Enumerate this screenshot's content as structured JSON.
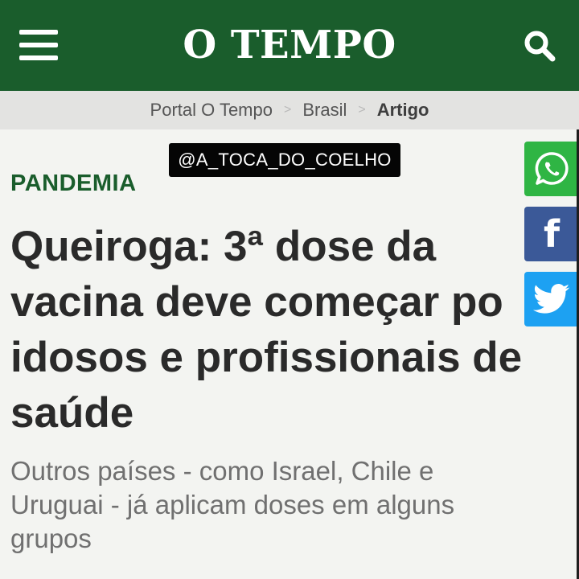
{
  "header": {
    "logo_text": "O TEMPO",
    "background_color": "#1a5d2c",
    "menu_icon": "hamburger-menu-icon",
    "search_icon": "search-icon"
  },
  "breadcrumb": {
    "items": [
      "Portal O Tempo",
      "Brasil",
      "Artigo"
    ],
    "separator": ">"
  },
  "watermark": {
    "text": "@A_TOCA_DO_COELHO"
  },
  "article": {
    "category": "PANDEMIA",
    "headline": "Queiroga: 3ª dose da\nvacina deve começar po\nidosos e profissionais de\nsaúde",
    "subtitle": "Outros países - como Israel, Chile e\nUruguai - já aplicam doses em alguns\ngrupos"
  },
  "share": {
    "buttons": [
      {
        "name": "whatsapp",
        "icon": "whatsapp-icon",
        "color": "#2fb544"
      },
      {
        "name": "facebook",
        "icon": "facebook-icon",
        "color": "#3b5998"
      },
      {
        "name": "twitter",
        "icon": "twitter-icon",
        "color": "#1da1f2"
      }
    ]
  }
}
